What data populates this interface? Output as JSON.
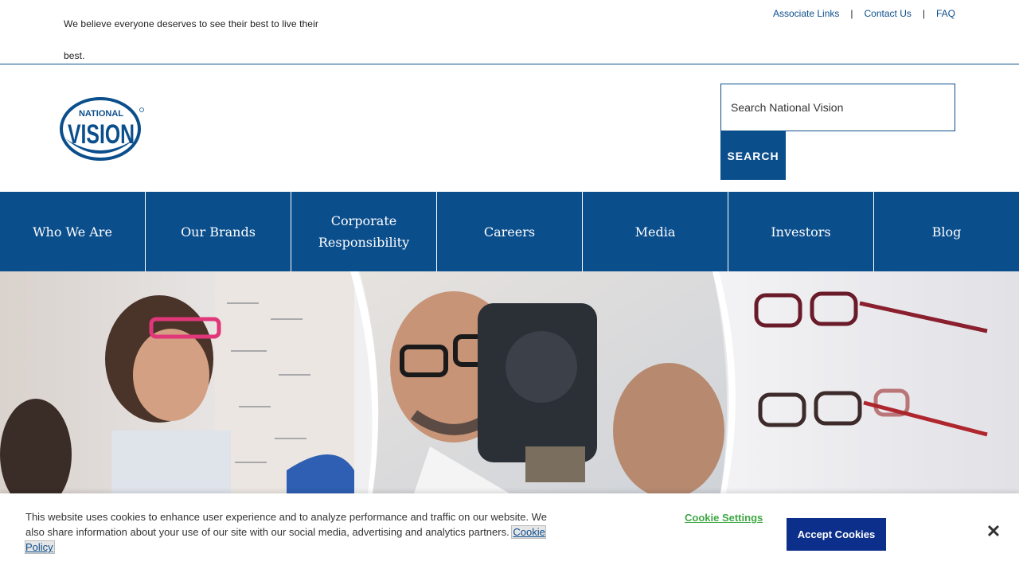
{
  "topbar": {
    "tagline": "We believe everyone deserves to see their best to live their best.",
    "links": [
      "Associate Links",
      "Contact Us",
      "FAQ"
    ],
    "separator": "|"
  },
  "header": {
    "logo_text_top": "NATIONAL",
    "logo_text_main": "VISION",
    "search": {
      "placeholder": "Search National Vision",
      "button_label": "SEARCH"
    }
  },
  "nav": {
    "items": [
      {
        "label": "Who We Are"
      },
      {
        "label": "Our Brands"
      },
      {
        "label": "Corporate Responsibility"
      },
      {
        "label": "Careers"
      },
      {
        "label": "Media"
      },
      {
        "label": "Investors"
      },
      {
        "label": "Blog"
      }
    ]
  },
  "cookie_banner": {
    "text": "This website uses cookies to enhance user experience and to analyze performance and traffic on our website. We also share information about your use of our site with our social media, advertising and analytics partners.",
    "policy_link": "Cookie Policy",
    "settings_label": "Cookie Settings",
    "accept_label": "Accept Cookies",
    "close_icon": "close-icon"
  },
  "colors": {
    "brand_blue": "#0b4e8c",
    "accept_blue": "#0b2f8a",
    "settings_green": "#3fa845"
  }
}
